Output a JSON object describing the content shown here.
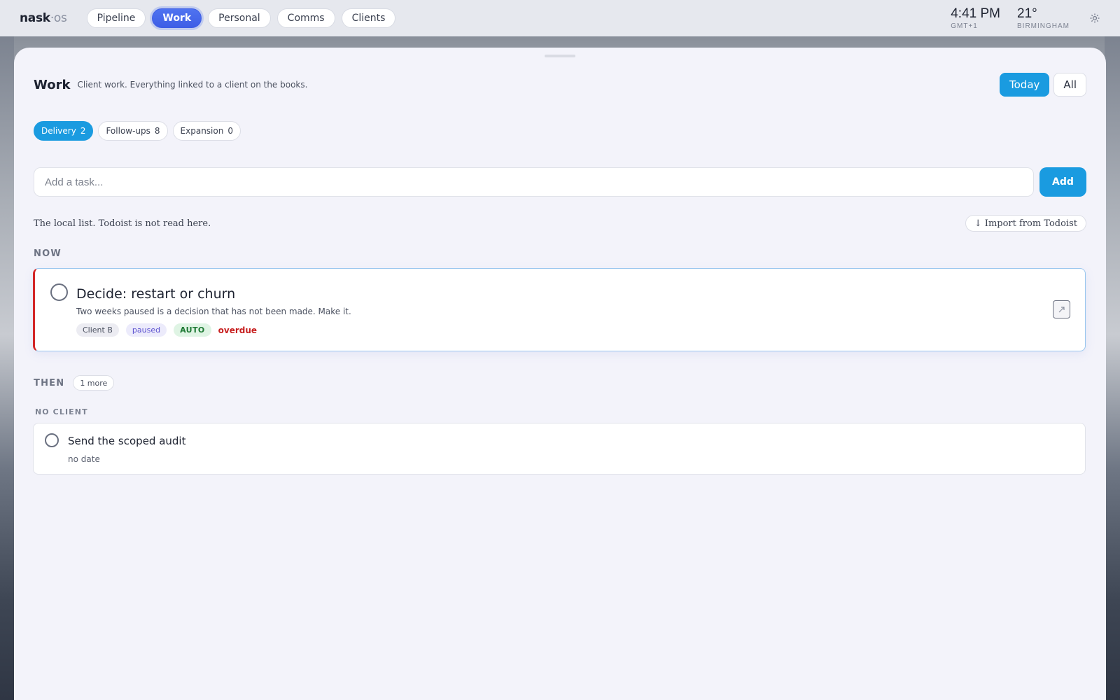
{
  "app": {
    "logo_main": "nask",
    "logo_suffix": "·os"
  },
  "nav": {
    "items": [
      {
        "label": "Pipeline",
        "active": false
      },
      {
        "label": "Work",
        "active": true
      },
      {
        "label": "Personal",
        "active": false
      },
      {
        "label": "Comms",
        "active": false
      },
      {
        "label": "Clients",
        "active": false
      }
    ]
  },
  "status": {
    "time": "4:41 PM",
    "timezone": "GMT+1",
    "temperature": "21°",
    "location": "BIRMINGHAM",
    "settings_icon": "gear-icon"
  },
  "page": {
    "title": "Work",
    "subtitle": "Client work. Everything linked to a client on the books.",
    "view_toggle": {
      "today": "Today",
      "all": "All",
      "selected": "Today"
    }
  },
  "filters": [
    {
      "label": "Delivery",
      "count": "2",
      "active": true
    },
    {
      "label": "Follow-ups",
      "count": "8",
      "active": false
    },
    {
      "label": "Expansion",
      "count": "0",
      "active": false
    }
  ],
  "add_task": {
    "placeholder": "Add a task...",
    "value": "",
    "button_label": "Add"
  },
  "source": {
    "note": "The local list. Todoist is not read here.",
    "import_label": "↓ Import from Todoist"
  },
  "now": {
    "label": "NOW",
    "task": {
      "title": "Decide: restart or churn",
      "description": "Two weeks paused is a decision that has not been made. Make it.",
      "client": "Client B",
      "state": "paused",
      "auto": "AUTO",
      "due": "overdue",
      "open_icon": "external-link-icon"
    }
  },
  "then": {
    "label": "THEN",
    "more": "1 more",
    "group": "NO CLIENT",
    "task": {
      "title": "Send the scoped audit",
      "meta": "no date"
    }
  },
  "colors": {
    "accent": "#1a9be0",
    "nav_active": "#3e5ee6",
    "overdue": "#c71f1f",
    "auto": "#1f7a35",
    "paused": "#5a4fcf"
  }
}
